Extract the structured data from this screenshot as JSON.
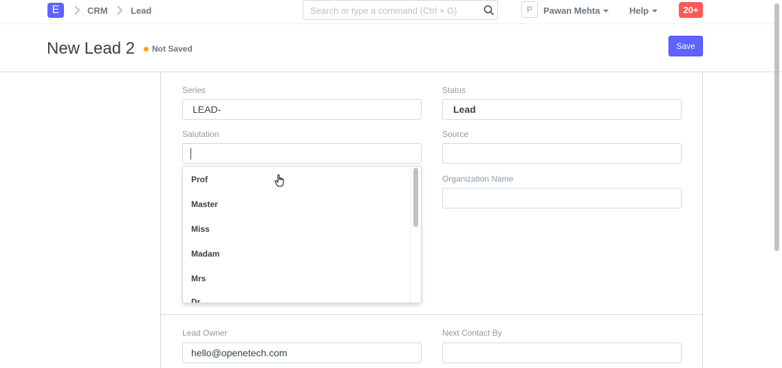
{
  "navbar": {
    "logo_letter": "E",
    "breadcrumbs": [
      "CRM",
      "Lead"
    ],
    "search_placeholder": "Search or type a command (Ctrl + G)",
    "avatar_letter": "P",
    "user_name": "Pawan Mehta",
    "help_label": "Help",
    "notifications_count": "20+"
  },
  "page": {
    "title": "New Lead 2",
    "status": "Not Saved",
    "save_label": "Save"
  },
  "form": {
    "series": {
      "label": "Series",
      "value": "LEAD-"
    },
    "status": {
      "label": "Status",
      "value": "Lead"
    },
    "salutation": {
      "label": "Salutation",
      "value": ""
    },
    "source": {
      "label": "Source",
      "value": ""
    },
    "organization_name": {
      "label": "Organization Name",
      "value": ""
    },
    "lead_owner": {
      "label": "Lead Owner",
      "value": "hello@openetech.com"
    },
    "next_contact_by": {
      "label": "Next Contact By",
      "value": ""
    }
  },
  "salutation_dropdown": {
    "options": [
      "Prof",
      "Master",
      "Miss",
      "Madam",
      "Mrs",
      "Dr"
    ]
  },
  "colors": {
    "primary": "#5e64ff",
    "notification": "#ff5858",
    "not_saved_indicator": "#ffa00a"
  }
}
